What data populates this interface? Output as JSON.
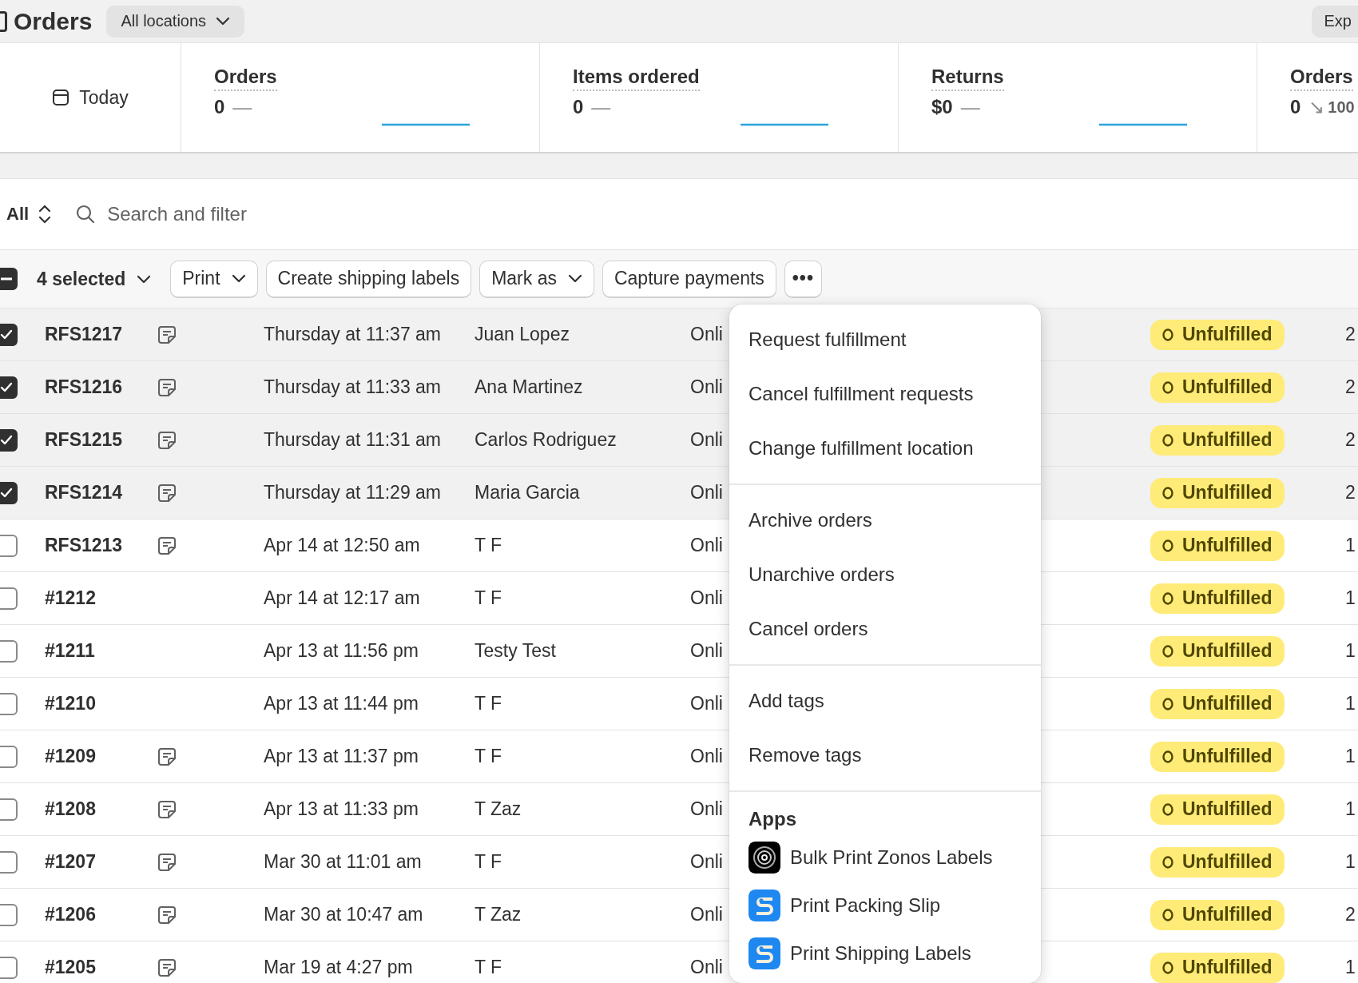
{
  "header": {
    "title": "Orders",
    "location_button": "All locations",
    "export_button": "Exp"
  },
  "stats": {
    "period": "Today",
    "cards": [
      {
        "label": "Orders",
        "value": "0",
        "trend": "—"
      },
      {
        "label": "Items ordered",
        "value": "0",
        "trend": "—"
      },
      {
        "label": "Returns",
        "value": "$0",
        "trend": "—"
      },
      {
        "label": "Orders",
        "value": "0",
        "trend": "↘",
        "change": "100"
      }
    ]
  },
  "filter": {
    "view": "All",
    "placeholder": "Search and filter"
  },
  "bulk_actions": {
    "select_all_partial": true,
    "selected_label": "4 selected",
    "buttons": [
      {
        "label": "Print",
        "kind": "dropdown"
      },
      {
        "label": "Create shipping labels",
        "kind": "plain"
      },
      {
        "label": "Mark as",
        "kind": "dropdown"
      },
      {
        "label": "Capture payments",
        "kind": "plain"
      },
      {
        "label": "•••",
        "kind": "more"
      }
    ]
  },
  "rows": [
    {
      "order": "RFS1217",
      "note": true,
      "date": "Thursday at 11:37 am",
      "customer": "Juan Lopez",
      "channel": "Onli",
      "status": "Unfulfilled",
      "column_8": "2",
      "selected": true
    },
    {
      "order": "RFS1216",
      "note": true,
      "date": "Thursday at 11:33 am",
      "customer": "Ana Martinez",
      "channel": "Onli",
      "status": "Unfulfilled",
      "column_8": "2",
      "selected": true
    },
    {
      "order": "RFS1215",
      "note": true,
      "date": "Thursday at 11:31 am",
      "customer": "Carlos Rodriguez",
      "channel": "Onli",
      "status": "Unfulfilled",
      "column_8": "2",
      "selected": true
    },
    {
      "order": "RFS1214",
      "note": true,
      "date": "Thursday at 11:29 am",
      "customer": "Maria Garcia",
      "channel": "Onli",
      "status": "Unfulfilled",
      "column_8": "2",
      "selected": true
    },
    {
      "order": "RFS1213",
      "note": true,
      "date": "Apr 14 at 12:50 am",
      "customer": "T F",
      "channel": "Onli",
      "status": "Unfulfilled",
      "column_8": "1",
      "selected": false
    },
    {
      "order": "#1212",
      "note": false,
      "date": "Apr 14 at 12:17 am",
      "customer": "T F",
      "channel": "Onli",
      "status": "Unfulfilled",
      "column_8": "1",
      "selected": false
    },
    {
      "order": "#1211",
      "note": false,
      "date": "Apr 13 at 11:56 pm",
      "customer": "Testy Test",
      "channel": "Onli",
      "status": "Unfulfilled",
      "column_8": "1",
      "selected": false
    },
    {
      "order": "#1210",
      "note": false,
      "date": "Apr 13 at 11:44 pm",
      "customer": "T F",
      "channel": "Onli",
      "status": "Unfulfilled",
      "column_8": "1",
      "selected": false
    },
    {
      "order": "#1209",
      "note": true,
      "date": "Apr 13 at 11:37 pm",
      "customer": "T F",
      "channel": "Onli",
      "status": "Unfulfilled",
      "column_8": "1",
      "selected": false
    },
    {
      "order": "#1208",
      "note": true,
      "date": "Apr 13 at 11:33 pm",
      "customer": "T Zaz",
      "channel": "Onli",
      "status": "Unfulfilled",
      "column_8": "1",
      "selected": false
    },
    {
      "order": "#1207",
      "note": true,
      "date": "Mar 30 at 11:01 am",
      "customer": "T F",
      "channel": "Onli",
      "status": "Unfulfilled",
      "column_8": "1",
      "selected": false
    },
    {
      "order": "#1206",
      "note": true,
      "date": "Mar 30 at 10:47 am",
      "customer": "T Zaz",
      "channel": "Onli",
      "status": "Unfulfilled",
      "column_8": "2",
      "selected": false
    },
    {
      "order": "#1205",
      "note": true,
      "date": "Mar 19 at 4:27 pm",
      "customer": "T F",
      "channel": "Onli",
      "status": "Unfulfilled",
      "column_8": "1",
      "selected": false
    }
  ],
  "menu": {
    "groups": [
      {
        "items": [
          {
            "label": "Request fulfillment"
          },
          {
            "label": "Cancel fulfillment requests"
          },
          {
            "label": "Change fulfillment location"
          }
        ]
      },
      {
        "items": [
          {
            "label": "Archive orders"
          },
          {
            "label": "Unarchive orders"
          },
          {
            "label": "Cancel orders"
          }
        ]
      },
      {
        "items": [
          {
            "label": "Add tags"
          },
          {
            "label": "Remove tags"
          }
        ]
      },
      {
        "heading": "Apps",
        "items": [
          {
            "label": "Bulk Print Zonos Labels",
            "kind": "rings"
          },
          {
            "label": "Print Packing Slip",
            "kind": "slip"
          },
          {
            "label": "Print Shipping Labels",
            "kind": "slip"
          }
        ]
      }
    ]
  }
}
